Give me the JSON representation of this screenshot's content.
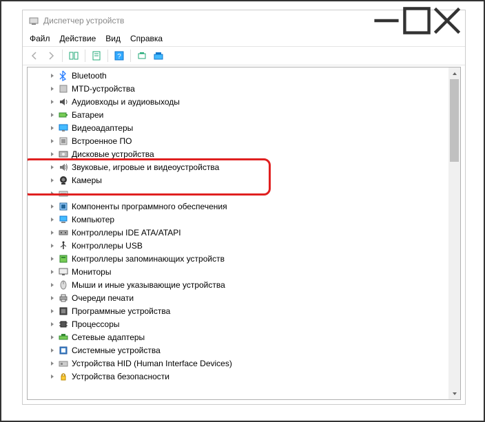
{
  "window": {
    "title": "Диспетчер устройств"
  },
  "menu": {
    "file": "Файл",
    "action": "Действие",
    "view": "Вид",
    "help": "Справка"
  },
  "tree": {
    "items": [
      {
        "label": "Bluetooth",
        "icon": "bluetooth"
      },
      {
        "label": "MTD-устройства",
        "icon": "mtd"
      },
      {
        "label": "Аудиовходы и аудиовыходы",
        "icon": "audio"
      },
      {
        "label": "Батареи",
        "icon": "battery"
      },
      {
        "label": "Видеоадаптеры",
        "icon": "display"
      },
      {
        "label": "Встроенное ПО",
        "icon": "firmware"
      },
      {
        "label": "Дисковые устройства",
        "icon": "disk"
      },
      {
        "label": "Звуковые, игровые и видеоустройства",
        "icon": "sound"
      },
      {
        "label": "Камеры",
        "icon": "camera"
      },
      {
        "label": "",
        "icon": "keyboard"
      },
      {
        "label": "Компоненты программного обеспечения",
        "icon": "software"
      },
      {
        "label": "Компьютер",
        "icon": "computer"
      },
      {
        "label": "Контроллеры IDE ATA/ATAPI",
        "icon": "ide"
      },
      {
        "label": "Контроллеры USB",
        "icon": "usb"
      },
      {
        "label": "Контроллеры запоминающих устройств",
        "icon": "storage"
      },
      {
        "label": "Мониторы",
        "icon": "monitor"
      },
      {
        "label": "Мыши и иные указывающие устройства",
        "icon": "mouse"
      },
      {
        "label": "Очереди печати",
        "icon": "printer"
      },
      {
        "label": "Программные устройства",
        "icon": "swdev"
      },
      {
        "label": "Процессоры",
        "icon": "cpu"
      },
      {
        "label": "Сетевые адаптеры",
        "icon": "network"
      },
      {
        "label": "Системные устройства",
        "icon": "system"
      },
      {
        "label": "Устройства HID (Human Interface Devices)",
        "icon": "hid"
      },
      {
        "label": "Устройства безопасности",
        "icon": "security"
      }
    ]
  },
  "highlight_indices": [
    7,
    8
  ]
}
